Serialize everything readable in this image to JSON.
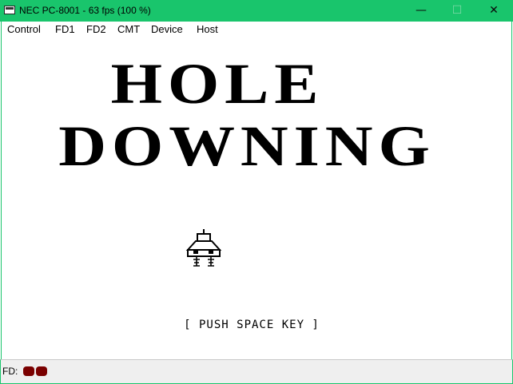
{
  "window": {
    "title": "NEC PC-8001 - 63 fps (100 %)",
    "minimize_glyph": "—",
    "maximize_glyph": "☐",
    "close_glyph": "✕"
  },
  "menu": {
    "items": [
      {
        "label": "Control"
      },
      {
        "label": "FD1"
      },
      {
        "label": "FD2"
      },
      {
        "label": "CMT"
      },
      {
        "label": "Device"
      },
      {
        "label": "Host"
      }
    ]
  },
  "game": {
    "title_line1": "HOLE",
    "title_line2": "DOWNING",
    "prompt": "[ PUSH SPACE KEY ]"
  },
  "status": {
    "fd_label": "FD:",
    "led_color": "#7a0000"
  },
  "colors": {
    "titlebar": "#19c56c",
    "screen_bg": "#ffffff",
    "status_bg": "#efefef"
  }
}
